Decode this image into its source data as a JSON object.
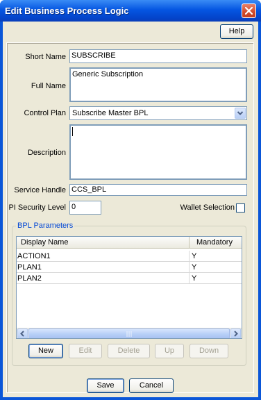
{
  "window": {
    "title": "Edit Business Process Logic"
  },
  "toolbar": {
    "help_label": "Help"
  },
  "form": {
    "short_name_label": "Short Name",
    "short_name_value": "SUBSCRIBE",
    "full_name_label": "Full Name",
    "full_name_value": "Generic Subscription",
    "control_plan_label": "Control Plan",
    "control_plan_value": "Subscribe Master BPL",
    "description_label": "Description",
    "description_value": "",
    "service_handle_label": "Service Handle",
    "service_handle_value": "CCS_BPL",
    "pi_security_label": "PI Security Level",
    "pi_security_value": "0",
    "wallet_selection_label": "Wallet Selection",
    "wallet_selection_checked": false
  },
  "bpl_parameters": {
    "title": "BPL Parameters",
    "columns": [
      "Display Name",
      "Mandatory"
    ],
    "rows": [
      {
        "name": "ACTION1",
        "mandatory": "Y"
      },
      {
        "name": "PLAN1",
        "mandatory": "Y"
      },
      {
        "name": "PLAN2",
        "mandatory": "Y"
      }
    ],
    "buttons": {
      "new": "New",
      "edit": "Edit",
      "delete": "Delete",
      "up": "Up",
      "down": "Down"
    }
  },
  "footer": {
    "save_label": "Save",
    "cancel_label": "Cancel"
  },
  "icons": {
    "close": "close-icon",
    "dropdown": "chevron-down-icon",
    "scroll_left": "arrow-left-icon",
    "scroll_right": "arrow-right-icon"
  },
  "colors": {
    "titlebar": "#0556e2",
    "dialog_bg": "#ece9d8",
    "group_title": "#0046d5"
  }
}
